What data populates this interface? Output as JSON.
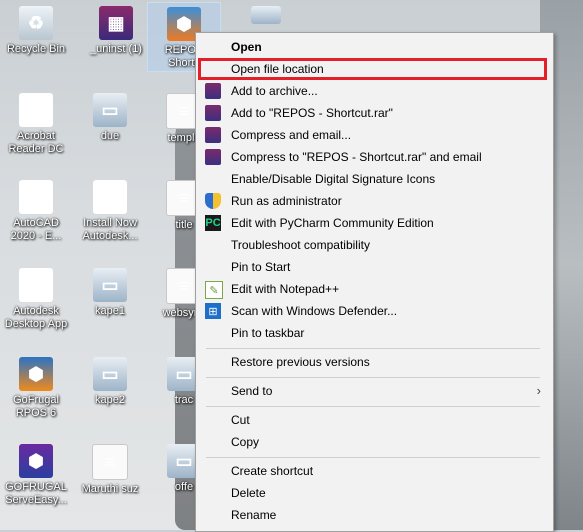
{
  "desktop": {
    "icons": [
      {
        "name": "Recycle Bin",
        "glyph": "♻"
      },
      {
        "name": "_uninst (1)",
        "glyph": "▦"
      },
      {
        "name": "REPOS - Shortcut",
        "line1": "REPOS",
        "line2": "Shortc",
        "glyph": "⬢"
      },
      {
        "name": "Acrobat Reader DC",
        "line1": "Acrobat",
        "line2": "Reader DC",
        "glyph": "A"
      },
      {
        "name": "due",
        "glyph": "▭"
      },
      {
        "name": "templa",
        "glyph": "≡"
      },
      {
        "name": "AutoCAD 2020 - E...",
        "line1": "AutoCAD",
        "line2": "2020 - E...",
        "glyph": "A"
      },
      {
        "name": "Install Now Autodesk...",
        "line1": "Install Now",
        "line2": "Autodesk...",
        "glyph": "A"
      },
      {
        "name": "title",
        "glyph": "≡"
      },
      {
        "name": "Autodesk Desktop App",
        "line1": "Autodesk",
        "line2": "Desktop App",
        "glyph": "A"
      },
      {
        "name": "kape1",
        "glyph": "▭"
      },
      {
        "name": "websync",
        "glyph": "≡"
      },
      {
        "name": "GoFrugal RPOS 6",
        "line1": "GoFrugal",
        "line2": "RPOS 6",
        "glyph": "⬢"
      },
      {
        "name": "kape2",
        "glyph": "▭"
      },
      {
        "name": "trac",
        "glyph": "▭"
      },
      {
        "name": "GOFRUGAL ServeEasy...",
        "line1": "GOFRUGAL",
        "line2": "ServeEasy...",
        "glyph": "⬢"
      },
      {
        "name": "Maruthi suz",
        "glyph": "≡"
      },
      {
        "name": "offe",
        "glyph": "▭"
      }
    ]
  },
  "menu": {
    "items": {
      "open": "Open",
      "open_file_location": "Open file location",
      "add_to_archive": "Add to archive...",
      "add_to_rar": "Add to \"REPOS - Shortcut.rar\"",
      "compress_email": "Compress and email...",
      "compress_to_rar_email": "Compress to \"REPOS - Shortcut.rar\" and email",
      "digital_signature": "Enable/Disable Digital Signature Icons",
      "run_as_admin": "Run as administrator",
      "pycharm": "Edit with PyCharm Community Edition",
      "troubleshoot": "Troubleshoot compatibility",
      "pin_start": "Pin to Start",
      "notepad": "Edit with Notepad++",
      "defender": "Scan with Windows Defender...",
      "pin_taskbar": "Pin to taskbar",
      "restore": "Restore previous versions",
      "send_to": "Send to",
      "cut": "Cut",
      "copy": "Copy",
      "create_shortcut": "Create shortcut",
      "delete": "Delete",
      "rename": "Rename"
    },
    "highlight_color": "#e3202a"
  }
}
